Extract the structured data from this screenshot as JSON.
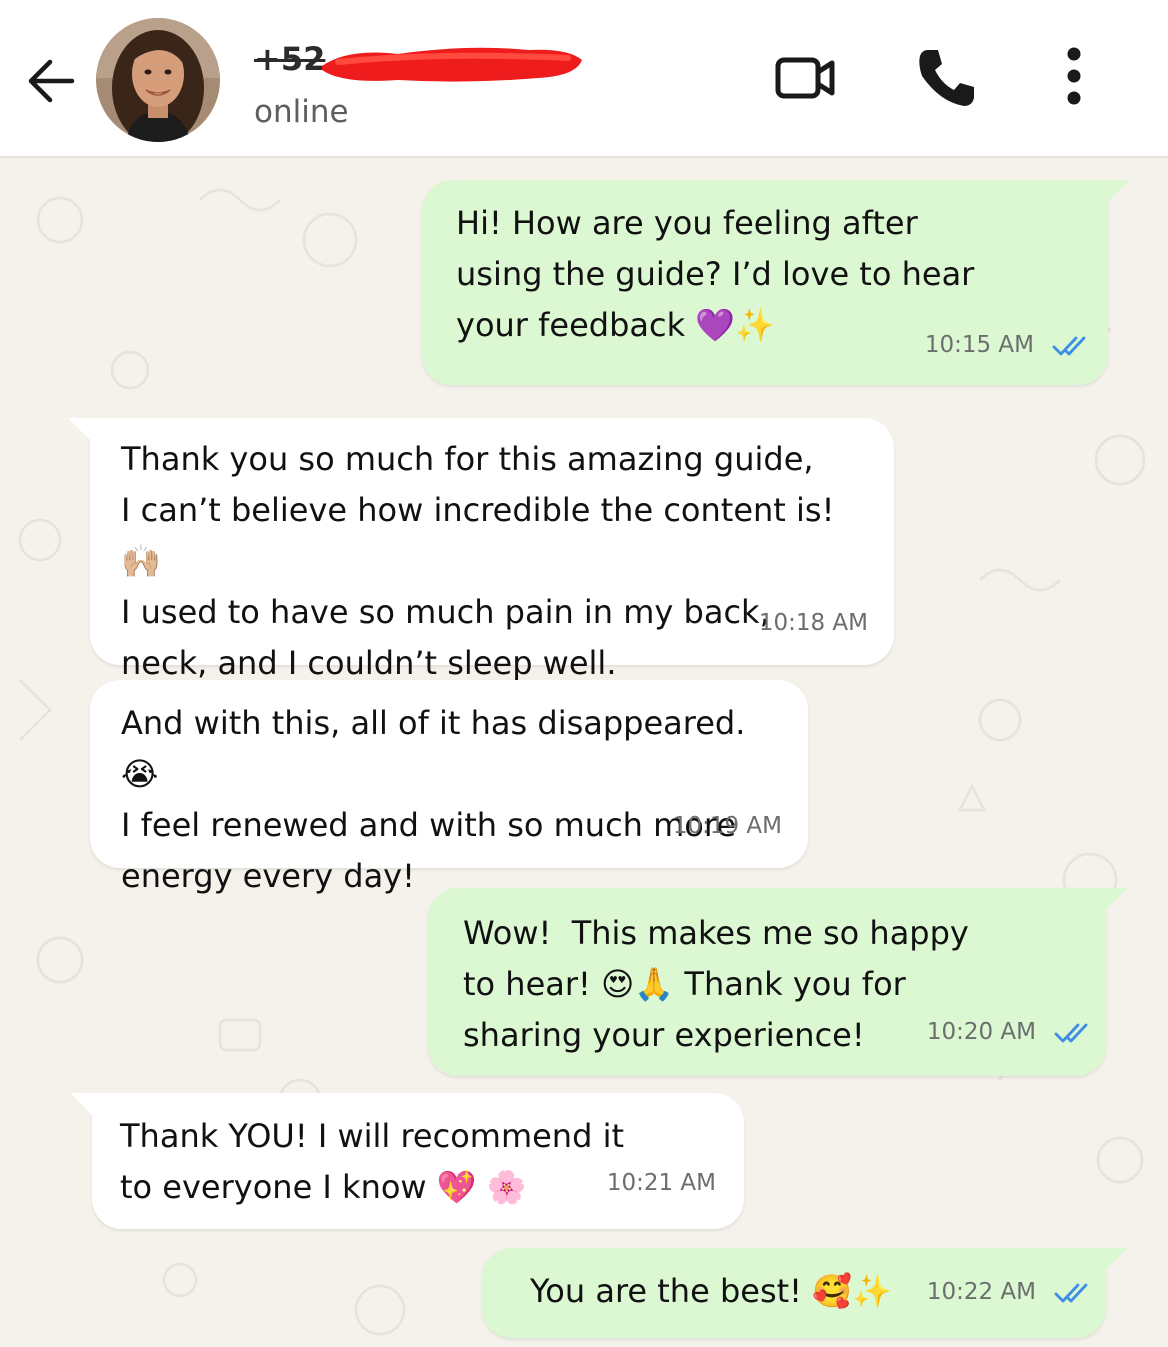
{
  "header": {
    "contact_number": "+52",
    "status": "online",
    "icons": {
      "back": "arrow-left-icon",
      "video": "video-camera-icon",
      "call": "phone-icon",
      "menu": "more-vertical-icon"
    }
  },
  "colors": {
    "outgoing_bubble": "#dcf8d3",
    "incoming_bubble": "#ffffff",
    "read_ticks": "#3d8ee6",
    "chat_background": "#f5f1eb",
    "redaction": "#ee1c1c"
  },
  "messages": [
    {
      "direction": "outgoing",
      "text": "Hi! How are you feeling after\nusing the guide? I’d love to hear\nyour feedback 💜✨",
      "time": "10:15 AM",
      "status": "read"
    },
    {
      "direction": "incoming",
      "text": "Thank you so much for this amazing guide,\nI can’t believe how incredible the content is! 🙌🏼\nI used to have so much pain in my back,\nneck, and I couldn’t sleep well.",
      "time": "10:18 AM"
    },
    {
      "direction": "incoming",
      "text": "And with this, all of it has disappeared. 😭\nI feel renewed and with so much more\nenergy every day!",
      "time": "10:19 AM"
    },
    {
      "direction": "outgoing",
      "text": "Wow!  This makes me so happy\nto hear! 😍🙏 Thank you for\nsharing your experience!",
      "time": "10:20 AM",
      "status": "read"
    },
    {
      "direction": "incoming",
      "text": "Thank YOU! I will recommend it\nto everyone I know 💖 🌸",
      "time": "10:21 AM"
    },
    {
      "direction": "outgoing",
      "text": "You are the best! 🥰✨",
      "time": "10:22 AM",
      "status": "read"
    }
  ]
}
